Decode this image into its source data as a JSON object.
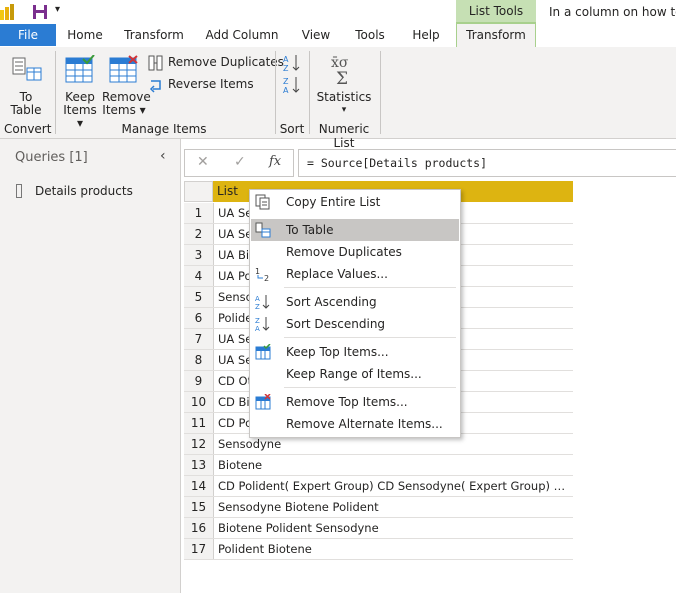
{
  "titlebar": {
    "contextual_label": "List Tools",
    "question_text": "In a column on how to f"
  },
  "tabs": [
    {
      "label": "File"
    },
    {
      "label": "Home"
    },
    {
      "label": "Transform"
    },
    {
      "label": "Add Column"
    },
    {
      "label": "View"
    },
    {
      "label": "Tools"
    },
    {
      "label": "Help"
    },
    {
      "label": "Transform"
    }
  ],
  "ribbon": {
    "convert": {
      "btn_line1": "To",
      "btn_line2": "Table",
      "group": "Convert"
    },
    "manage": {
      "keep_line1": "Keep",
      "keep_line2": "Items ▾",
      "remove_line1": "Remove",
      "remove_line2": "Items ▾",
      "remove_dup": "Remove Duplicates",
      "reverse": "Reverse Items",
      "group": "Manage Items"
    },
    "sort": {
      "group": "Sort"
    },
    "numeric": {
      "stats_label": "Statistics",
      "stats_arrow": "▾",
      "group": "Numeric List"
    }
  },
  "queries": {
    "title": "Queries [1]",
    "item": "Details products",
    "collapse_glyph": "‹"
  },
  "formula": {
    "text": "= Source[Details products]",
    "cancel": "✕",
    "commit": "✓",
    "fx": "fx"
  },
  "grid": {
    "header": "List",
    "rows": [
      {
        "n": "1",
        "v": "UA Sen"
      },
      {
        "n": "2",
        "v": "UA Sen"
      },
      {
        "n": "3",
        "v": "UA Bio                                                            Group)  UA Polide..."
      },
      {
        "n": "4",
        "v": "UA Poli"
      },
      {
        "n": "5",
        "v": "Sensod"
      },
      {
        "n": "6",
        "v": "Polider"
      },
      {
        "n": "7",
        "v": "UA Ser                                                            ert  Group)  UA Bioten..."
      },
      {
        "n": "8",
        "v": "UA Ser"
      },
      {
        "n": "9",
        "v": "CD Otr"
      },
      {
        "n": "10",
        "v": "CD Bio                                                          t  Group)  CD Poliden..."
      },
      {
        "n": "11",
        "v": "CD Pol"
      },
      {
        "n": "12",
        "v": "Sensodyne"
      },
      {
        "n": "13",
        "v": "Biotene"
      },
      {
        "n": "14",
        "v": "CD Polident( Expert  Group) CD Sensodyne( Expert  Group)  CD Biotene..."
      },
      {
        "n": "15",
        "v": "Sensodyne Biotene Polident"
      },
      {
        "n": "16",
        "v": "Biotene Polident Sensodyne"
      },
      {
        "n": "17",
        "v": "Polident Biotene"
      }
    ]
  },
  "context_menu": {
    "items": [
      {
        "label": "Copy Entire List",
        "icon": "copy-icon"
      },
      {
        "label": "To Table",
        "icon": "to-table-icon"
      },
      {
        "label": "Remove Duplicates",
        "icon": ""
      },
      {
        "label": "Replace Values...",
        "icon": "replace-values-icon"
      },
      {
        "label": "Sort Ascending",
        "icon": "sort-ascending-icon"
      },
      {
        "label": "Sort Descending",
        "icon": "sort-descending-icon"
      },
      {
        "label": "Keep Top Items...",
        "icon": "keep-top-icon"
      },
      {
        "label": "Keep Range of Items...",
        "icon": ""
      },
      {
        "label": "Remove Top Items...",
        "icon": "remove-top-icon"
      },
      {
        "label": "Remove Alternate Items...",
        "icon": ""
      }
    ]
  },
  "colors": {
    "accent": "#2b7cd3",
    "context_green": "#c6e0b4",
    "header_gold": "#ddb411",
    "highlight": "#c8c6c4"
  }
}
